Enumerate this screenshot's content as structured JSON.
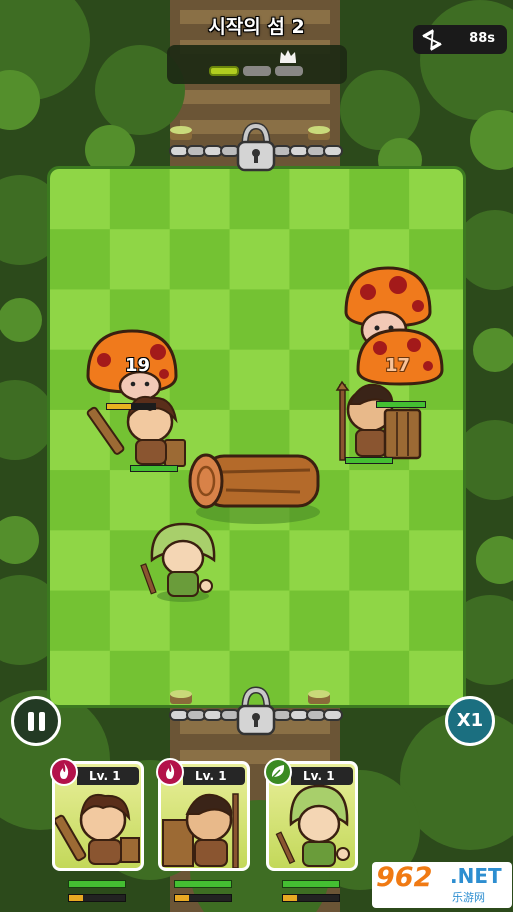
{
  "header": {
    "title": "시작의 섬 2",
    "timer": "88s",
    "stage_progress": {
      "completed": 1,
      "total": 3
    }
  },
  "board": {
    "columns": 7,
    "rows": 9
  },
  "units": {
    "mushroom_left_hp_text": "19",
    "mushroom_right_hp_text": "17"
  },
  "controls": {
    "speed_label": "X1"
  },
  "cards": [
    {
      "level": "Lv. 1",
      "element": "fire",
      "hero": "sword-warrior",
      "badge_color": "#b3124a"
    },
    {
      "level": "Lv. 1",
      "element": "fire",
      "hero": "spear-warrior",
      "badge_color": "#b3124a"
    },
    {
      "level": "Lv. 1",
      "element": "leaf",
      "hero": "hooded-ranger",
      "badge_color": "#3a8a22"
    }
  ],
  "watermark": {
    "number": "962",
    "domain": ".NET",
    "cn": "乐游网"
  },
  "colors": {
    "grass_light": "#8fd646",
    "grass_dark": "#74c233",
    "hp": "#44bf32",
    "xp": "#e8a923"
  }
}
